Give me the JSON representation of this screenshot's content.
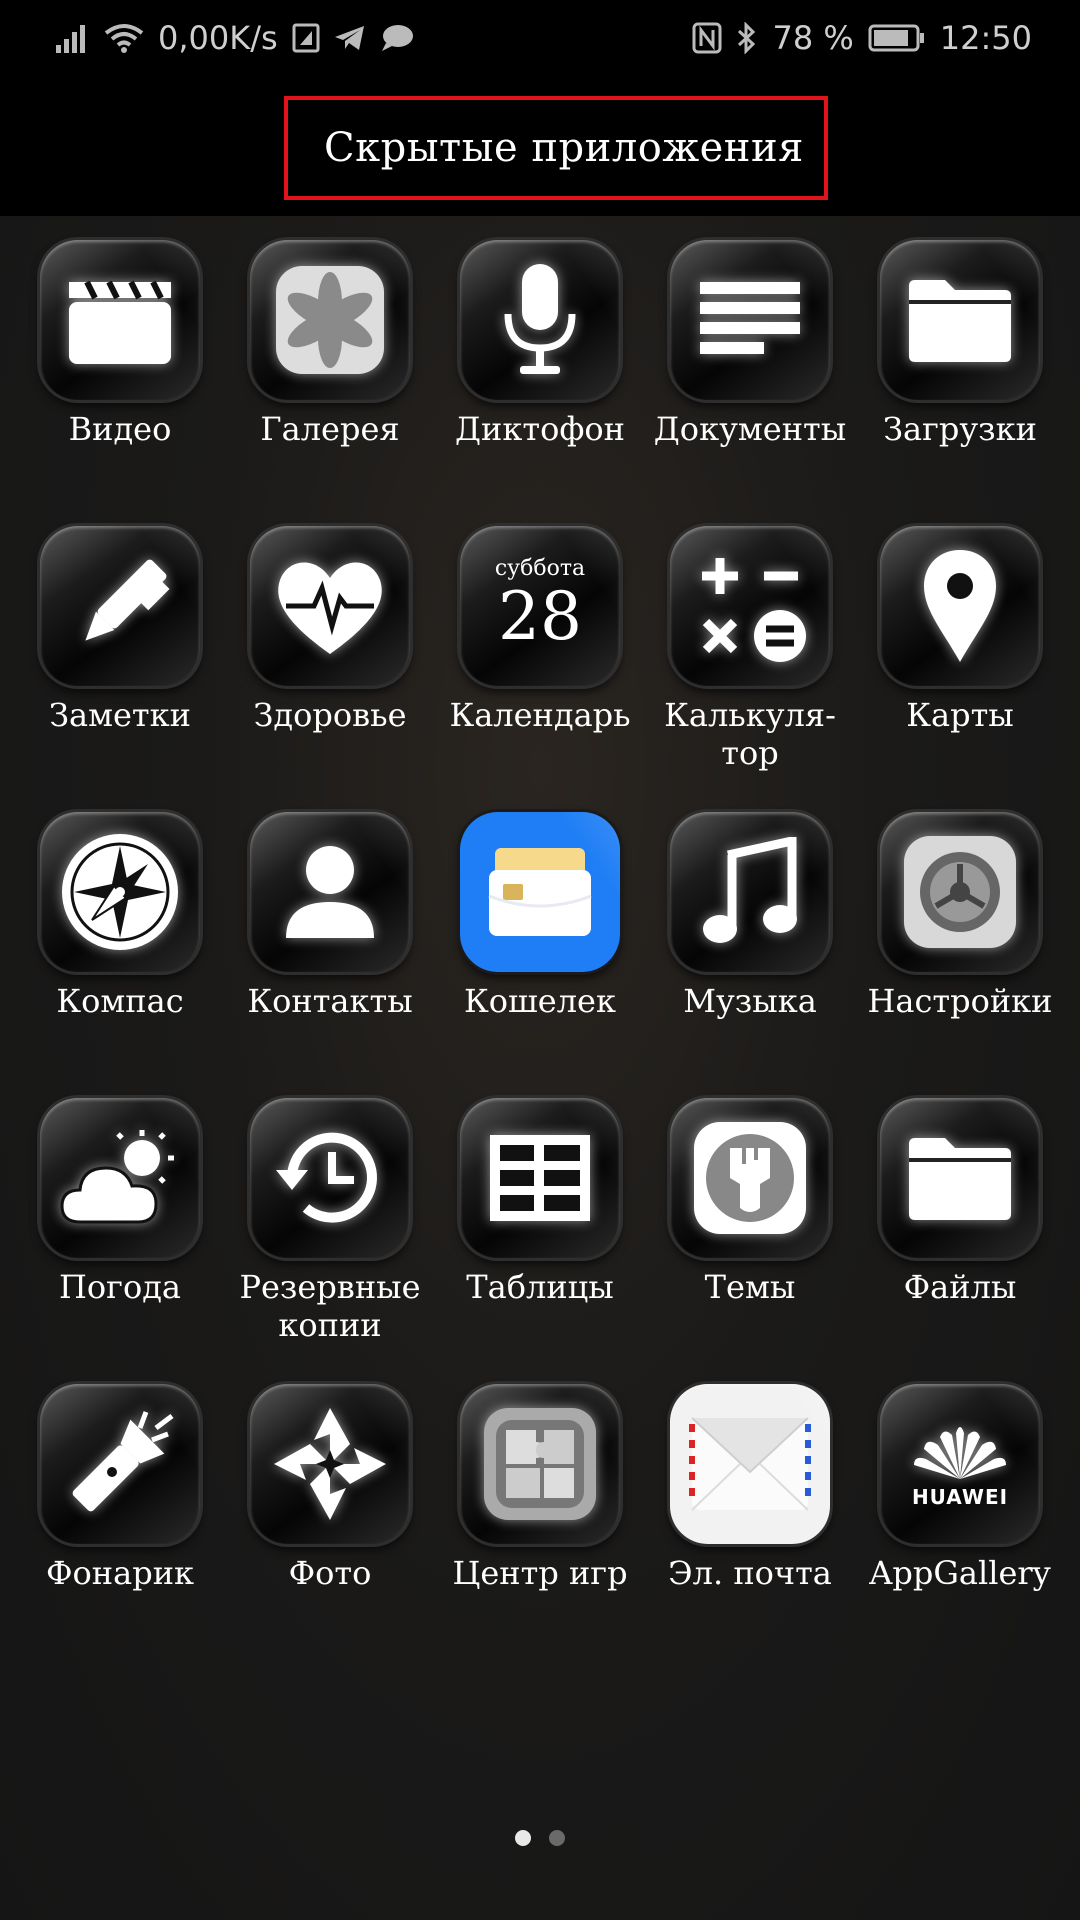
{
  "status_bar": {
    "net_speed": "0,00K/s",
    "battery": "78 %",
    "time": "12:50"
  },
  "header": {
    "title": "Скрытые приложения"
  },
  "apps": [
    {
      "label": "Видео",
      "icon": "video-clapper-icon"
    },
    {
      "label": "Галерея",
      "icon": "gallery-flower-icon"
    },
    {
      "label": "Диктофон",
      "icon": "microphone-icon"
    },
    {
      "label": "Документы",
      "icon": "document-lines-icon"
    },
    {
      "label": "Загрузки",
      "icon": "folder-icon"
    },
    {
      "label": "Заметки",
      "icon": "pen-icon"
    },
    {
      "label": "Здоровье",
      "icon": "heart-pulse-icon"
    },
    {
      "label": "Календарь",
      "icon": "calendar-icon",
      "weekday": "суббота",
      "day": "28"
    },
    {
      "label": "Калькуля-\nтор",
      "icon": "calculator-icon"
    },
    {
      "label": "Карты",
      "icon": "map-pin-icon"
    },
    {
      "label": "Компас",
      "icon": "compass-icon"
    },
    {
      "label": "Контакты",
      "icon": "contact-person-icon"
    },
    {
      "label": "Кошелек",
      "icon": "wallet-icon"
    },
    {
      "label": "Музыка",
      "icon": "music-note-icon"
    },
    {
      "label": "Настройки",
      "icon": "settings-gear-icon"
    },
    {
      "label": "Погода",
      "icon": "weather-cloud-sun-icon"
    },
    {
      "label": "Резервные копии",
      "icon": "backup-history-icon"
    },
    {
      "label": "Таблицы",
      "icon": "spreadsheet-icon"
    },
    {
      "label": "Темы",
      "icon": "themes-brush-icon"
    },
    {
      "label": "Файлы",
      "icon": "files-folder-icon"
    },
    {
      "label": "Фонарик",
      "icon": "flashlight-icon"
    },
    {
      "label": "Фото",
      "icon": "photo-pinwheel-icon"
    },
    {
      "label": "Центр игр",
      "icon": "game-center-puzzle-icon"
    },
    {
      "label": "Эл. почта",
      "icon": "email-envelope-icon"
    },
    {
      "label": "AppGallery",
      "icon": "huawei-appgallery-icon",
      "brand": "HUAWEI"
    }
  ],
  "pager": {
    "pages": 2,
    "current": 1
  },
  "colors": {
    "highlight_box": "#e0141c",
    "wallet_blue": "#1f7ef5"
  }
}
